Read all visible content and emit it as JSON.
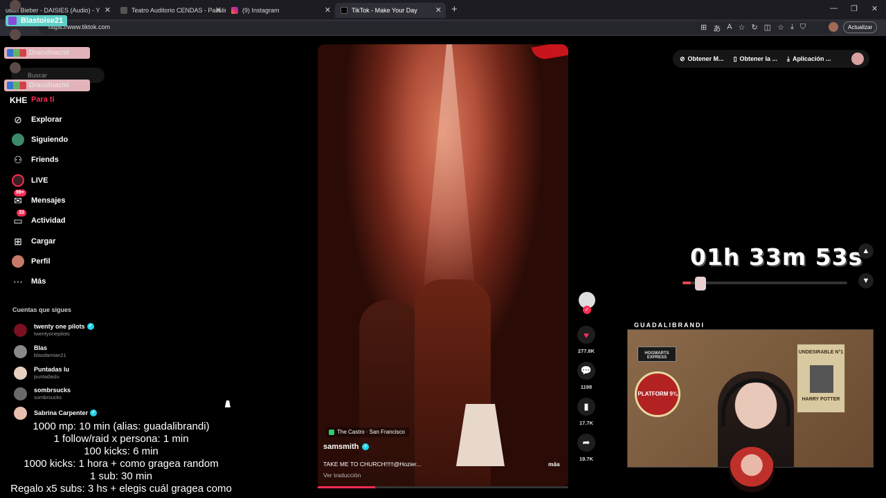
{
  "browser": {
    "tabs": [
      {
        "title": "ustin Bieber - DAISIES (Audio) - Y",
        "close": "✕"
      },
      {
        "title": "Teatro Auditorio CENDAS - Passlin",
        "close": "✕"
      },
      {
        "title": "(9) Instagram",
        "close": "✕"
      },
      {
        "title": "TikTok - Make Your Day",
        "close": "✕"
      }
    ],
    "new_tab": "+",
    "url": "https://www.tiktok.com",
    "update_button": "Actualizar",
    "window_controls": {
      "minimize": "—",
      "maximize": "❐",
      "close": "✕"
    }
  },
  "overlay": {
    "badge_user": "Blastoise21",
    "pink_user_1": "Draculinacmi",
    "pink_user_2": "Draculinacmi",
    "search_placeholder": "Buscar"
  },
  "sidebar": {
    "brand": "KHE",
    "for_you": "Para ti",
    "nav": [
      {
        "label": "Explorar",
        "icon": "compass-icon"
      },
      {
        "label": "Siguiendo",
        "icon": "following-avatar-icon"
      },
      {
        "label": "Friends",
        "icon": "friends-icon"
      },
      {
        "label": "LIVE",
        "icon": "live-icon"
      },
      {
        "label": "Mensajes",
        "icon": "messages-icon",
        "badge": "99+"
      },
      {
        "label": "Actividad",
        "icon": "activity-icon",
        "badge": "33"
      },
      {
        "label": "Cargar",
        "icon": "upload-icon"
      },
      {
        "label": "Perfil",
        "icon": "profile-avatar-icon"
      },
      {
        "label": "Más",
        "icon": "more-dots-icon"
      }
    ],
    "following_title": "Cuentas que sigues",
    "accounts": [
      {
        "name": "twenty one pilots",
        "handle": "twentyonepilots",
        "verified": true,
        "color": "#7a1020"
      },
      {
        "name": "Blas",
        "handle": "blasdamian21",
        "verified": false,
        "color": "#8a8a8a"
      },
      {
        "name": "Puntadas lu",
        "handle": "puntadaslu",
        "verified": false,
        "color": "#e8d0c0"
      },
      {
        "name": "sombrsucks",
        "handle": "sombrsucks",
        "verified": false,
        "color": "#6a6a6a"
      },
      {
        "name": "Sabrina Carpenter",
        "handle": "",
        "verified": true,
        "color": "#e8c0b0"
      }
    ]
  },
  "captions": [
    "1000 mp: 10 min (alias: guadalibrandi)",
    "1 follow/raid x persona: 1 min",
    "100 kicks: 6 min",
    "1000 kicks: 1 hora + como gragea random",
    "1 sub: 30 min",
    "Regalo x5 subs: 3 hs + elegis cuál gragea como"
  ],
  "video": {
    "location": "The Castro · San Francisco",
    "author": "samsmith",
    "caption": "TAKE ME TO CHURCH!!!!!@Hozier...",
    "more": "más",
    "translate": "Ver traducción",
    "progress_percent": 23
  },
  "actions": {
    "likes": "277.8K",
    "comments": "1198",
    "saves": "17.7K",
    "shares": "19.7K"
  },
  "top_pills": {
    "pill1": "Obtener M...",
    "pill2": "Obtener la ...",
    "pill3": "Aplicación ..."
  },
  "stream": {
    "timer": "01h 33m 53s",
    "timer_progress_percent": 5,
    "streamer_name": "GUADALIBRANDI",
    "poster_wanted": "UNDESIRABLE N°1",
    "poster_harry": "HARRY POTTER",
    "poster_express": "HOGWARTS EXPRESS",
    "platform_sign": "PLATFORM 9¾"
  },
  "colors": {
    "accent": "#fe2c55",
    "verified": "#20d5ec"
  }
}
